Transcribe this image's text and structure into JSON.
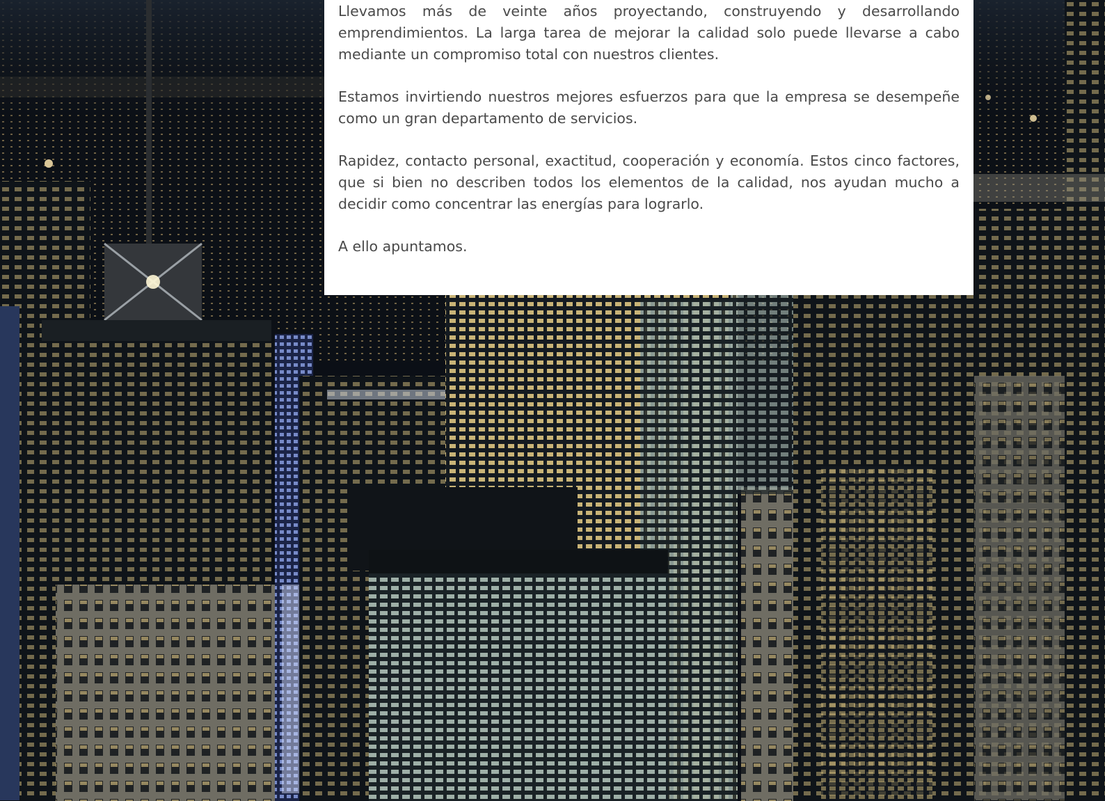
{
  "background": {
    "image": "night-city-skyline",
    "colors": {
      "sky": "#0a0d14",
      "building_dark": "#11161d",
      "window_warm": "#f3d98a",
      "window_cool": "#cfe6e6",
      "window_blue": "#9fb5ff"
    }
  },
  "text_card": {
    "paragraphs": [
      "Llevamos más de veinte años proyectando, construyendo y desarrollando emprendimientos. La larga tarea de mejorar la calidad solo puede llevarse a cabo mediante un compromiso total con nuestros clientes.",
      "Estamos invirtiendo nuestros mejores esfuerzos para que la empresa se desempeñe como un gran departamento de servicios.",
      "Rapidez, contacto personal, exactitud, cooperación y economía. Estos cinco factores, que si bien no describen todos los elementos de la calidad, nos ayudan mucho a decidir como concentrar las energías para lograrlo.",
      "A ello apuntamos."
    ]
  }
}
